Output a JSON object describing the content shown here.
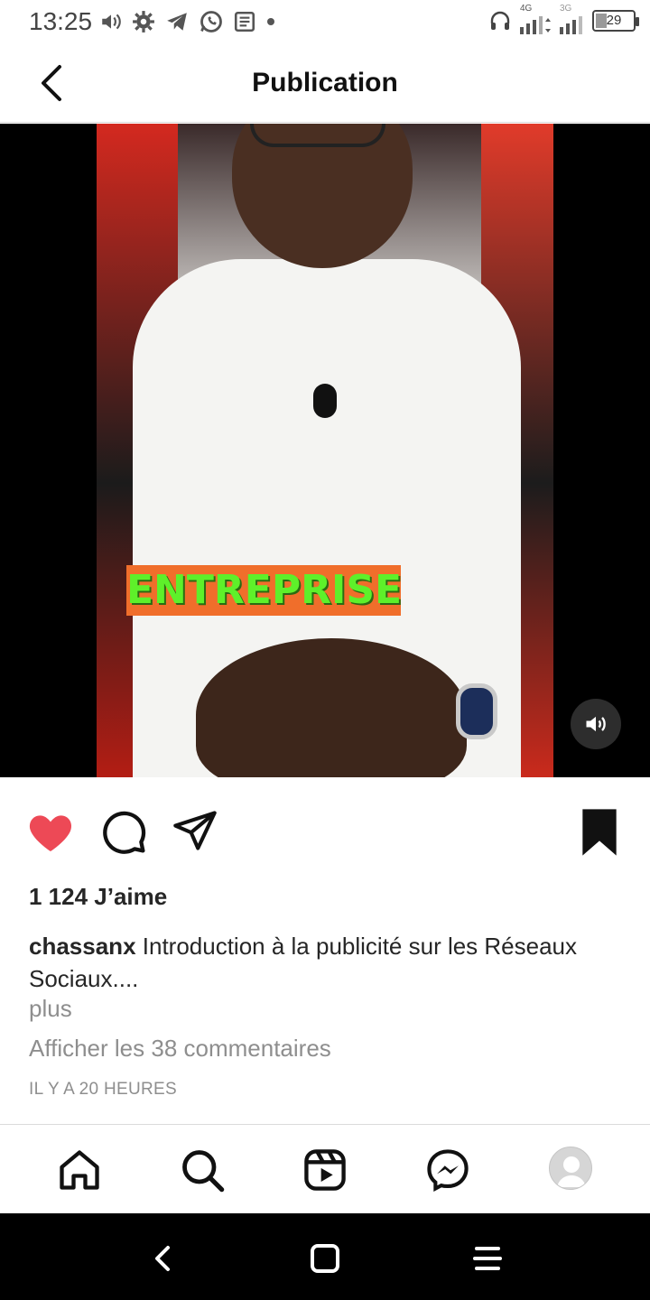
{
  "status_bar": {
    "time": "13:25",
    "network_4g": "4G",
    "network_3g": "3G",
    "battery": "29",
    "icons": [
      "volume-icon",
      "settings-icon",
      "telegram-icon",
      "whatsapp-icon",
      "news-icon",
      "dot-icon",
      "headphones-icon",
      "signal-icon"
    ]
  },
  "header": {
    "title": "Publication"
  },
  "media": {
    "overlay_text": "ENTREPRISE",
    "sound_icon": "volume-icon"
  },
  "actions": {
    "like_color": "#ed4956",
    "icons": [
      "heart-icon",
      "comment-icon",
      "share-icon",
      "bookmark-icon"
    ]
  },
  "post": {
    "likes": "1 124 J’aime",
    "username": "chassanx",
    "caption_text": " Introduction à la publicité sur les Réseaux Sociaux....",
    "more_label": "plus",
    "comments_label": "Afficher les 38 commentaires",
    "time_ago": "IL Y A 20 HEURES"
  },
  "tabbar": {
    "items": [
      "home-icon",
      "search-icon",
      "reels-icon",
      "messenger-icon",
      "profile-avatar"
    ]
  },
  "system_nav": {
    "items": [
      "back-icon",
      "home-square-icon",
      "menu-icon"
    ]
  }
}
